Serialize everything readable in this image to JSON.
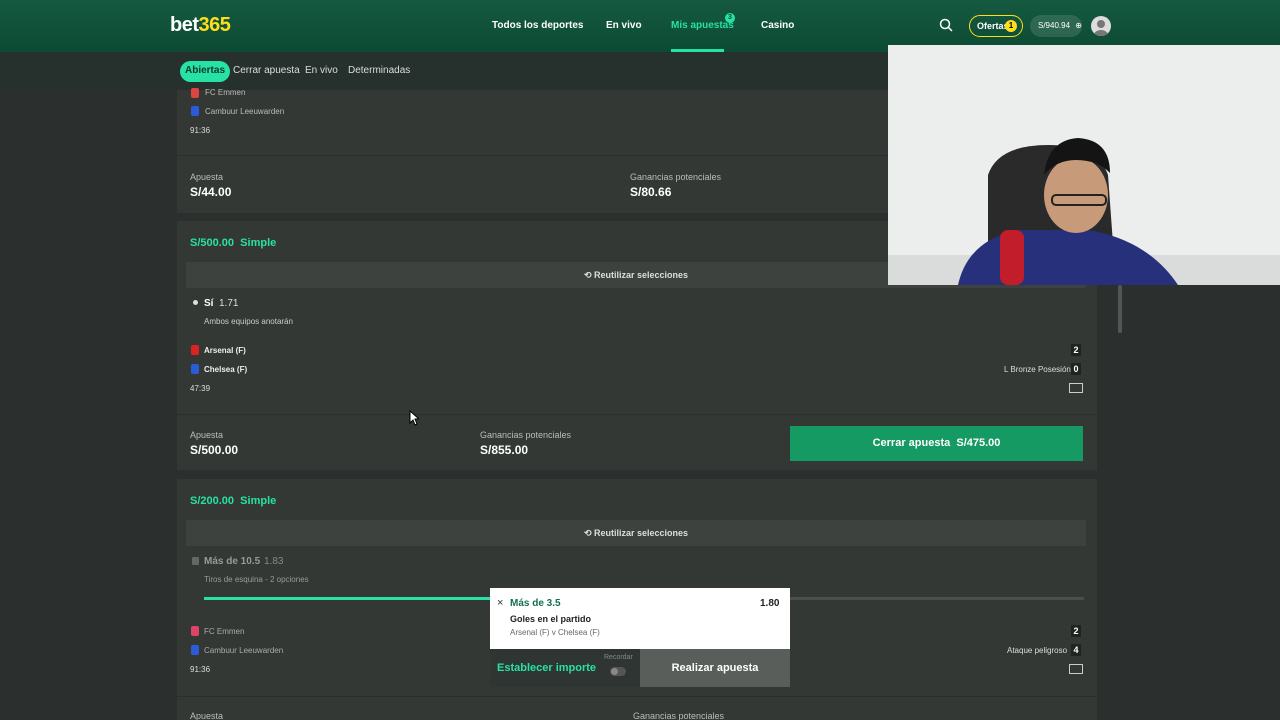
{
  "header": {
    "logo_main": "bet",
    "logo_num": "365",
    "nav": [
      "Todos los deportes",
      "En vivo",
      "Mis apuestas",
      "Casino"
    ],
    "nav_badge": "3",
    "ofertas_label": "Ofertas",
    "ofertas_count": "1",
    "balance": "S/940.94"
  },
  "tabs": [
    "Abiertas",
    "Cerrar apuesta",
    "En vivo",
    "Determinadas"
  ],
  "card1": {
    "team1": "FC Emmen",
    "team2": "Cambuur Leeuwarden",
    "time": "91:36",
    "stake_label": "Apuesta",
    "stake": "S/44.00",
    "winnings_label": "Ganancias potenciales",
    "winnings": "S/80.66"
  },
  "card2": {
    "title_amount": "S/500.00",
    "title_type": "Simple",
    "reuse": "Reutilizar selecciones",
    "selection": "Sí",
    "odds": "1.71",
    "market": "Ambos equipos anotarán",
    "team1": "Arsenal (F)",
    "team2": "Chelsea (F)",
    "score1": "2",
    "score2": "0",
    "status": "L Bronze Posesión",
    "time": "47:39",
    "stake_label": "Apuesta",
    "stake": "S/500.00",
    "winnings_label": "Ganancias potenciales",
    "winnings": "S/855.00",
    "cashout_label": "Cerrar apuesta",
    "cashout_value": "S/475.00"
  },
  "card3": {
    "title_amount": "S/200.00",
    "title_type": "Simple",
    "reuse": "Reutilizar selecciones",
    "selection": "Más de 10.5",
    "odds": "1.83",
    "market": "Tiros de esquina - 2 opciones",
    "team1": "FC Emmen",
    "team2": "Cambuur Leeuwarden",
    "score1": "2",
    "score2": "4",
    "status": "Ataque peligroso",
    "time": "91:36",
    "stake_label": "Apuesta",
    "winnings_label": "Ganancias potenciales",
    "progress": 0.33
  },
  "betslip": {
    "selection": "Más de 3.5",
    "odds": "1.80",
    "market": "Goles en el partido",
    "event": "Arsenal (F) v Chelsea (F)",
    "stake_button": "Establecer importe",
    "remember": "Recordar",
    "place_button": "Realizar apuesta"
  },
  "colors": {
    "accent": "#27e1a5",
    "header": "#145a40",
    "cashout": "#159a63",
    "logo_yellow": "#ffdf1b"
  }
}
